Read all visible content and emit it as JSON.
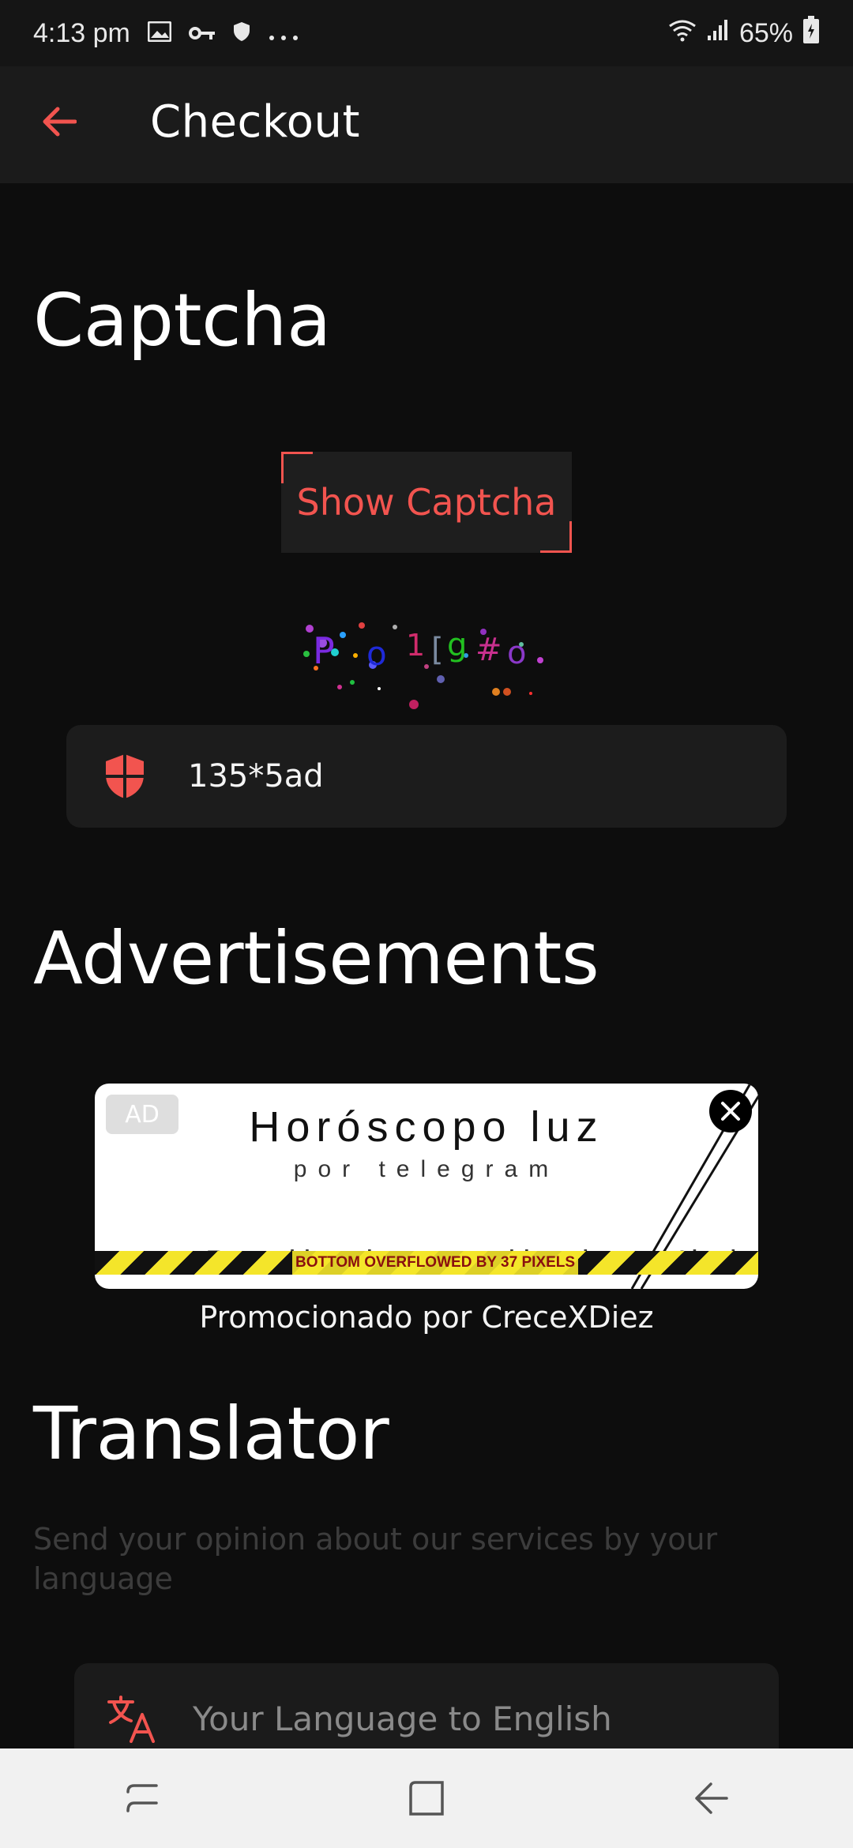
{
  "status_bar": {
    "time": "4:13 pm",
    "battery": "65%"
  },
  "app_bar": {
    "title": "Checkout"
  },
  "captcha": {
    "section_title": "Captcha",
    "show_button_label": "Show Captcha",
    "characters": [
      "P",
      "o",
      "1",
      "[",
      "g",
      "#",
      "o"
    ],
    "input_value": "135*5ad"
  },
  "advertisements": {
    "section_title": "Advertisements",
    "ad_badge": "AD",
    "headline": "Horóscopo luz",
    "subheadline": "por telegram",
    "clipped_text": "Predicciones diarias Visitar",
    "overflow_warning": "BOTTOM OVERFLOWED BY 37 PIXELS",
    "sponsor_text": "Promocionado por CreceXDiez"
  },
  "translator": {
    "section_title": "Translator",
    "description": "Send your opinion about our services by your language",
    "option_label": "Your Language to English"
  },
  "colors": {
    "accent": "#f2544f",
    "background": "#0d0d0d",
    "card": "#1c1c1c"
  }
}
